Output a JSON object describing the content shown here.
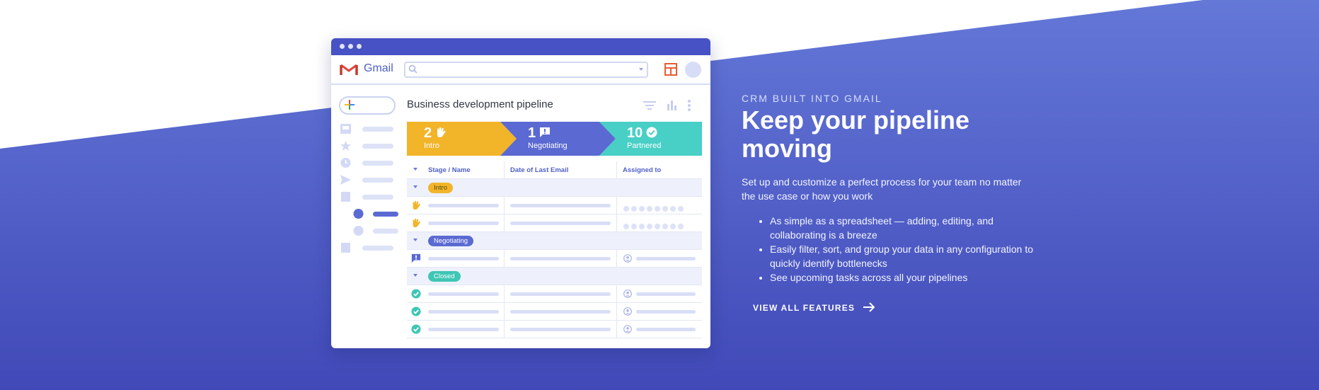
{
  "colors": {
    "background_top": "#ffffff",
    "band_light": "#6478d8",
    "band_dark": "#4149b8",
    "titlebar": "#4752c4",
    "accent": "#5060c8",
    "stage_intro": "#f2b429",
    "stage_negotiating": "#5b69d2",
    "stage_partnered": "#48cfc6",
    "closed_check": "#3fc6b5"
  },
  "app": {
    "brand": "Gmail",
    "icons": [
      "gmail-logo-icon",
      "search-icon",
      "layout-icon",
      "avatar"
    ]
  },
  "sidebar": {
    "compose_icon": "plus-icon",
    "items": [
      {
        "icon": "inbox-icon"
      },
      {
        "icon": "star-icon"
      },
      {
        "icon": "clock-icon"
      },
      {
        "icon": "send-icon"
      },
      {
        "icon": "folder-icon"
      },
      {
        "icon": "pipeline-dot-icon",
        "active": true
      },
      {
        "icon": "pipeline-dot-icon"
      },
      {
        "icon": "folder-icon"
      }
    ]
  },
  "pipeline": {
    "title": "Business development pipeline",
    "toolbar_icons": [
      "filter-icon",
      "chart-icon",
      "more-icon"
    ],
    "stages": [
      {
        "count": "2",
        "name": "Intro",
        "icon": "hand-icon"
      },
      {
        "count": "1",
        "name": "Negotiating",
        "icon": "alert-icon"
      },
      {
        "count": "10",
        "name": "Partnered",
        "icon": "check-icon"
      }
    ],
    "columns": [
      "Stage / Name",
      "Date of Last Email",
      "Assigned to"
    ],
    "groups": [
      {
        "label": "Intro",
        "rows": 2,
        "row_icon": "hand-icon",
        "assigned": "dots"
      },
      {
        "label": "Negotiating",
        "rows": 1,
        "row_icon": "alert-icon",
        "assigned": "person"
      },
      {
        "label": "Closed",
        "rows": 3,
        "row_icon": "check-icon",
        "assigned": "person"
      }
    ]
  },
  "copy": {
    "eyebrow": "CRM BUILT INTO GMAIL",
    "headline": "Keep your pipeline moving",
    "sub": "Set up and customize a perfect process for your team no matter the use case or how you work",
    "bullets": [
      "As simple as a spreadsheet — adding, editing, and collaborating is a breeze",
      "Easily filter, sort, and group your data in any configuration to quickly identify bottlenecks",
      "See upcoming tasks across all your pipelines"
    ],
    "cta": "VIEW ALL FEATURES"
  }
}
